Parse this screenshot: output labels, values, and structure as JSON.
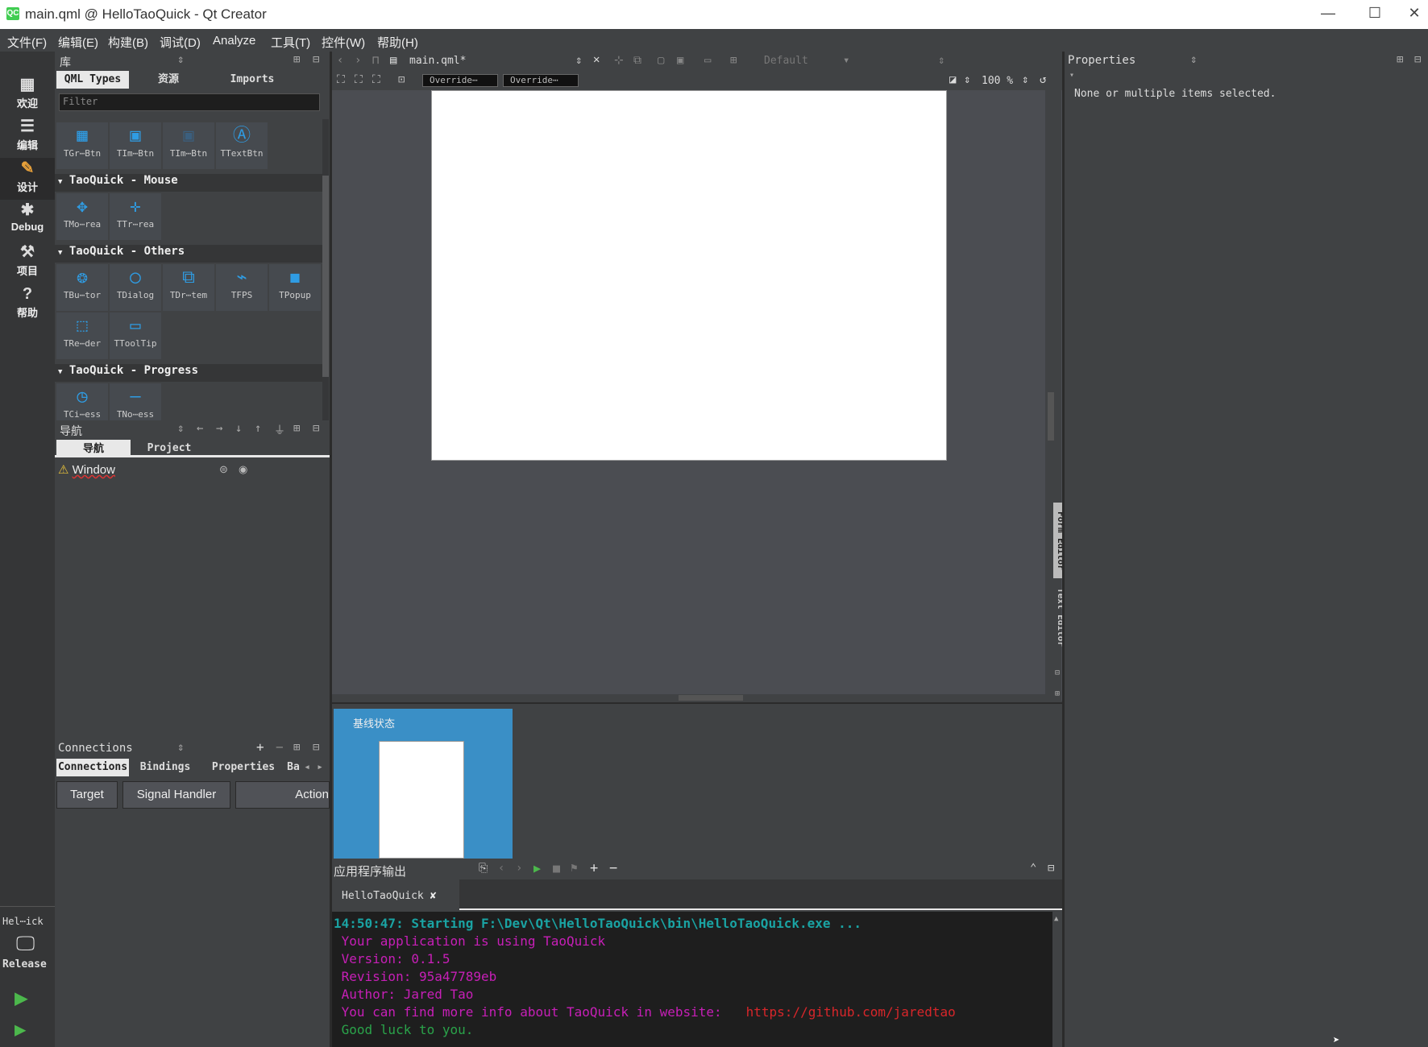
{
  "window": {
    "title": "main.qml @ HelloTaoQuick - Qt Creator",
    "logo": "QC",
    "min": "—",
    "max": "☐",
    "close": "✕"
  },
  "menu": [
    "文件(F)",
    "编辑(E)",
    "构建(B)",
    "调试(D)",
    "Analyze",
    "工具(T)",
    "控件(W)",
    "帮助(H)"
  ],
  "modes": [
    {
      "label": "欢迎",
      "icon": "grid-icon",
      "glyph": "▦"
    },
    {
      "label": "编辑",
      "icon": "document-icon",
      "glyph": "☰"
    },
    {
      "label": "设计",
      "icon": "pencil-icon",
      "glyph": "✎"
    },
    {
      "label": "Debug",
      "icon": "bug-icon",
      "glyph": "✱"
    },
    {
      "label": "项目",
      "icon": "wrench-icon",
      "glyph": "⚒"
    },
    {
      "label": "帮助",
      "icon": "help-icon",
      "glyph": "?"
    }
  ],
  "kit": {
    "project": "Hel⋯ick",
    "config": "Release"
  },
  "library": {
    "title": "库",
    "tabs": [
      "QML Types",
      "资源",
      "Imports"
    ],
    "filter_placeholder": "Filter",
    "top_items": [
      "TGr⋯Btn",
      "TIm⋯Btn",
      "TIm⋯Btn",
      "TTextBtn"
    ],
    "groups": [
      {
        "name": "TaoQuick - Mouse",
        "items": [
          "TMo⋯rea",
          "TTr⋯rea"
        ]
      },
      {
        "name": "TaoQuick - Others",
        "items": [
          "TBu⋯tor",
          "TDialog",
          "TDr⋯tem",
          "TFPS",
          "TPopup",
          "TRe⋯der",
          "TToolTip"
        ]
      },
      {
        "name": "TaoQuick - Progress",
        "items": [
          "TCi⋯ess",
          "TNo⋯ess"
        ]
      }
    ]
  },
  "navigator": {
    "title": "导航",
    "tabs": [
      "导航",
      "Project"
    ],
    "root": "Window"
  },
  "connections": {
    "title": "Connections",
    "tabs": [
      "Connections",
      "Bindings",
      "Properties",
      "Ba"
    ],
    "columns": [
      "Target",
      "Signal Handler",
      "Action"
    ]
  },
  "editor": {
    "file": "main.qml*",
    "state_default": "Default",
    "override1": "Override⋯",
    "override2": "Override⋯",
    "zoom": "100 %",
    "side_tabs": [
      "Form Editor",
      "Text Editor"
    ]
  },
  "states": {
    "base_state": "基线状态"
  },
  "properties": {
    "title": "Properties",
    "message": "None or multiple items selected."
  },
  "output": {
    "title": "应用程序输出",
    "tab": "HelloTaoQuick",
    "lines": [
      {
        "text": "14:50:47: Starting F:\\Dev\\Qt\\HelloTaoQuick\\bin\\HelloTaoQuick.exe ...",
        "color": "#1aa3a3"
      },
      {
        "text": " Your application is using TaoQuick",
        "color": "#c71fb7"
      },
      {
        "text": " Version: 0.1.5",
        "color": "#c71fb7"
      },
      {
        "text": " Revision: 95a47789eb",
        "color": "#c71fb7"
      },
      {
        "text": " Author: Jared Tao",
        "color": "#c71fb7"
      },
      {
        "text": " You can find more info about TaoQuick in website:",
        "color": "#c71fb7",
        "link": "https://github.com/jaredtao"
      },
      {
        "text": " Good luck to you.",
        "color": "#2aa34a"
      }
    ]
  },
  "colors": {
    "accent": "#3a8fc6",
    "link": "#d8262a"
  }
}
